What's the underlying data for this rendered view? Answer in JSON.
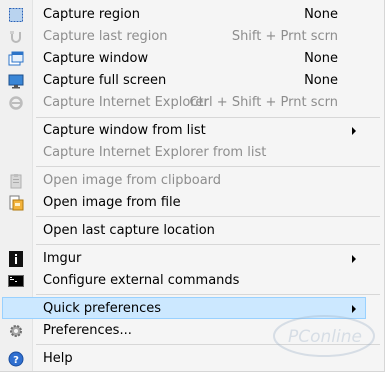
{
  "menu": {
    "items": [
      {
        "label": "Capture region",
        "shortcut": "None",
        "icon": "region-capture-icon",
        "enabled": true
      },
      {
        "label": "Capture last region",
        "shortcut": "Shift + Prnt scrn",
        "icon": "last-region-icon",
        "enabled": false
      },
      {
        "label": "Capture window",
        "shortcut": "None",
        "icon": "window-capture-icon",
        "enabled": true
      },
      {
        "label": "Capture full screen",
        "shortcut": "None",
        "icon": "monitor-icon",
        "enabled": true
      },
      {
        "label": "Capture Internet Explorer",
        "shortcut": "Ctrl + Shift + Prnt scrn",
        "icon": "internet-explorer-icon",
        "enabled": false
      },
      {
        "label": "Capture window from list",
        "submenu": true,
        "enabled": true
      },
      {
        "label": "Capture Internet Explorer from list",
        "enabled": false
      },
      {
        "label": "Open image from clipboard",
        "icon": "clipboard-icon",
        "enabled": false
      },
      {
        "label": "Open image from file",
        "icon": "open-file-icon",
        "enabled": true
      },
      {
        "label": "Open last capture location",
        "enabled": true
      },
      {
        "label": "Imgur",
        "icon": "imgur-icon",
        "submenu": true,
        "enabled": true
      },
      {
        "label": "Configure external commands",
        "icon": "console-icon",
        "enabled": true
      },
      {
        "label": "Quick preferences",
        "submenu": true,
        "enabled": true,
        "highlighted": true
      },
      {
        "label": "Preferences...",
        "icon": "gear-icon",
        "enabled": true
      },
      {
        "label": "Help",
        "icon": "help-icon",
        "enabled": true
      }
    ]
  },
  "colors": {
    "highlight_fill": "#cce8ff",
    "highlight_border": "#99d1ff",
    "disabled_text": "#8d8d8d"
  }
}
